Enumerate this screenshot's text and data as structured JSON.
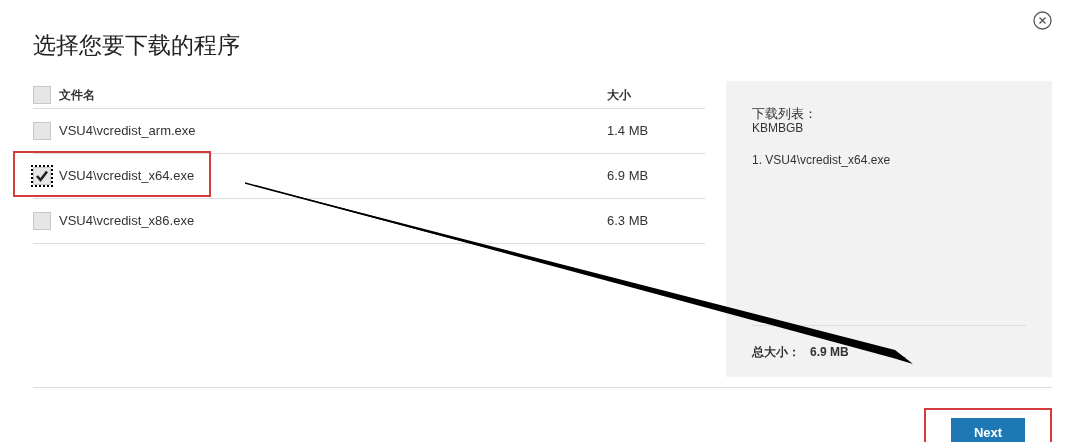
{
  "title": "选择您要下载的程序",
  "table": {
    "select_all": {
      "checked": false
    },
    "columns": [
      "文件名",
      "大小"
    ],
    "rows": [
      {
        "name": "VSU4\\vcredist_arm.exe",
        "size": "1.4 MB",
        "checked": false,
        "highlighted": false
      },
      {
        "name": "VSU4\\vcredist_x64.exe",
        "size": "6.9 MB",
        "checked": true,
        "highlighted": true
      },
      {
        "name": "VSU4\\vcredist_x86.exe",
        "size": "6.3 MB",
        "checked": false,
        "highlighted": false
      }
    ]
  },
  "summary": {
    "heading": "下载列表：",
    "code": "KBMBGB",
    "items": [
      "1. VSU4\\vcredist_x64.exe"
    ],
    "total_label": "总大小：",
    "total_value": "6.9 MB"
  },
  "next_button": {
    "label": "Next",
    "highlighted": true
  }
}
